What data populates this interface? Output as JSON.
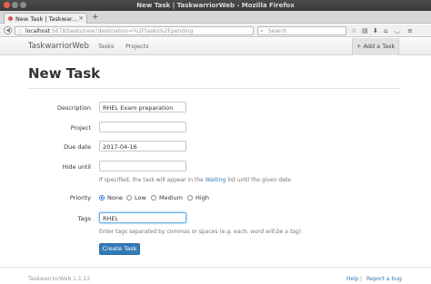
{
  "window": {
    "title": "New Task | TaskwarriorWeb - Mozilla Firefox"
  },
  "browser": {
    "tab_title": "New Task | Taskwar...",
    "tab_close": "×",
    "new_tab": "+",
    "back_glyph": "◀",
    "url_host": "localhost",
    "url_rest": ":5678/tasks/new?destination=%2Ftasks%2Fpending",
    "search_placeholder": "Search",
    "icons": [
      "star-icon",
      "reader-icon",
      "download-icon",
      "home-icon",
      "pocket-icon",
      "menu-icon"
    ]
  },
  "app": {
    "brand": "TaskwarriorWeb",
    "nav": [
      "Tasks",
      "Projects"
    ],
    "add_task": "+ Add a Task"
  },
  "page": {
    "title": "New Task"
  },
  "form": {
    "description": {
      "label": "Description",
      "value": "RHEL Exam preparation"
    },
    "project": {
      "label": "Project",
      "value": ""
    },
    "due": {
      "label": "Due date",
      "value": "2017-04-16"
    },
    "hide_until": {
      "label": "Hide until",
      "value": "",
      "help_prefix": "If specified, the task will appear in the ",
      "help_link": "Waiting",
      "help_suffix": " list until the given date."
    },
    "priority": {
      "label": "Priority",
      "options": [
        "None",
        "Low",
        "Medium",
        "High"
      ],
      "selected": "None"
    },
    "tags": {
      "label": "Tags",
      "value": "RHEL",
      "help_prefix": "Enter tags separated by commas or spaces (e.g. ",
      "help_example": "each, word will,be a tag",
      "help_suffix": ")"
    },
    "submit": "Create Task"
  },
  "footer": {
    "version": "TaskwarriorWeb 1.1.12",
    "help": "Help",
    "separator": "|",
    "report": "Report a bug"
  }
}
